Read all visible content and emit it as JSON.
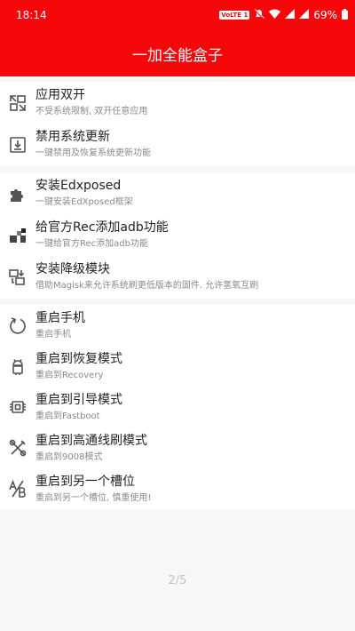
{
  "status_bar": {
    "time": "18:14",
    "volte": "VoLTE 1",
    "battery": "69%"
  },
  "app_bar": {
    "title": "一加全能盒子"
  },
  "groups": [
    {
      "items": [
        {
          "title": "应用双开",
          "subtitle": "不受系统限制, 双开任意应用",
          "icon": "clone-app-icon"
        },
        {
          "title": "禁用系统更新",
          "subtitle": "一键禁用及恢复系统更新功能",
          "icon": "download-box-icon"
        }
      ]
    },
    {
      "items": [
        {
          "title": "安装Edxposed",
          "subtitle": "一键安装EdXposed框架",
          "icon": "puzzle-icon"
        },
        {
          "title": "给官方Rec添加adb功能",
          "subtitle": "一键给官方Rec添加adb功能",
          "icon": "blocks-icon"
        },
        {
          "title": "安装降级模块",
          "subtitle": "借助Magisk来允许系统刷更低版本的固件. 允许氢氧互刷",
          "icon": "downgrade-icon"
        }
      ]
    },
    {
      "items": [
        {
          "title": "重启手机",
          "subtitle": "重启手机",
          "icon": "restart-icon"
        },
        {
          "title": "重启到恢复模式",
          "subtitle": "重启到Recovery",
          "icon": "android-icon"
        },
        {
          "title": "重启到引导模式",
          "subtitle": "重启到Fastboot",
          "icon": "chip-icon"
        },
        {
          "title": "重启到高通线刷模式",
          "subtitle": "重启到9008模式",
          "icon": "tools-icon"
        },
        {
          "title": "重启到另一个槽位",
          "subtitle": "重启到另一个槽位, 慎重使用!",
          "icon": "ab-slot-icon"
        }
      ]
    }
  ],
  "page_indicator": "2/5"
}
